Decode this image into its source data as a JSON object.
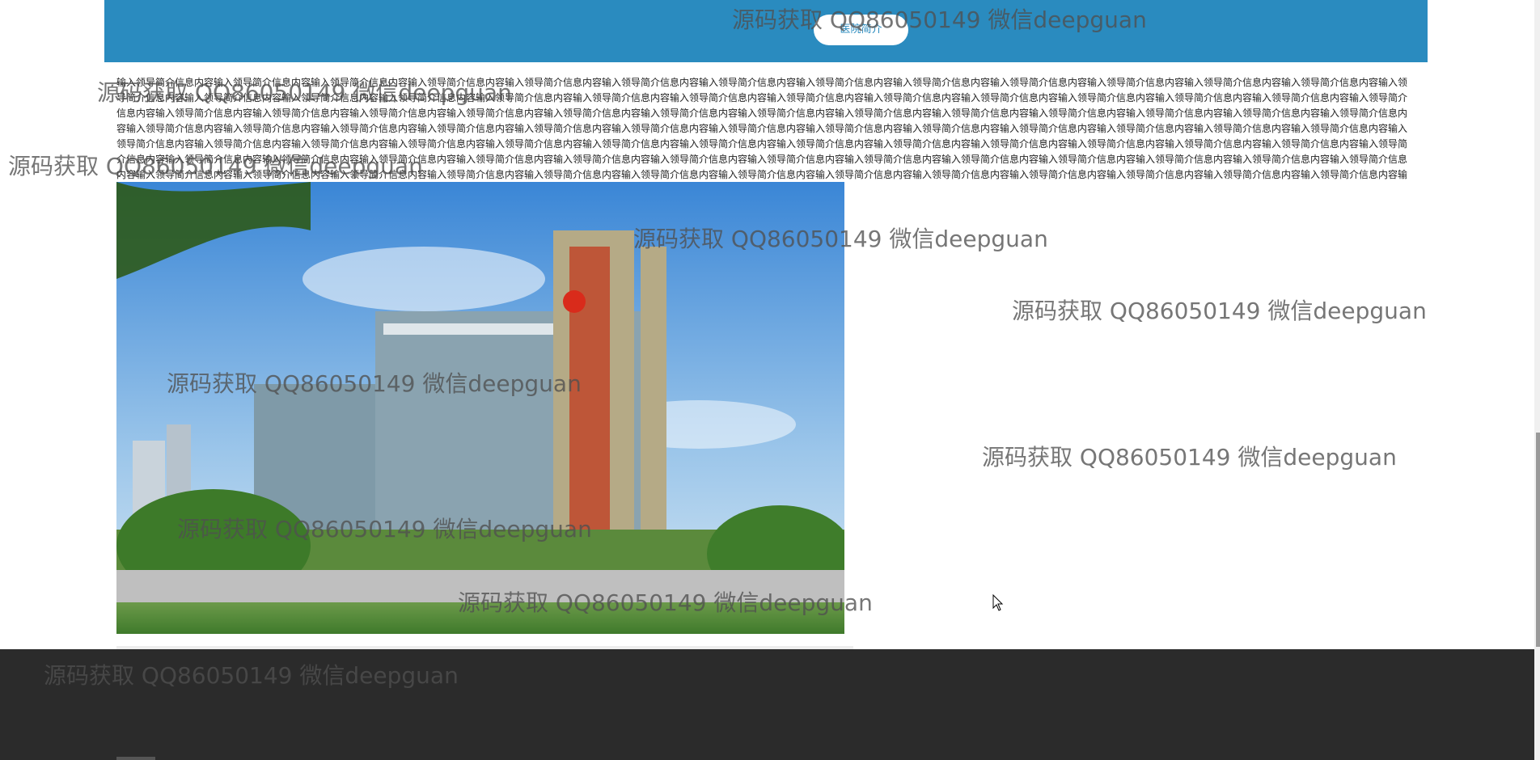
{
  "banner": {
    "color": "#2a8bbf",
    "pill_label": "医院简介"
  },
  "intro": {
    "text": "输入领导简介信息内容输入领导简介信息内容输入领导简介信息内容输入领导简介信息内容输入领导简介信息内容输入领导简介信息内容输入领导简介信息内容输入领导简介信息内容输入领导简介信息内容输入领导简介信息内容输入领导简介信息内容输入领导简介信息内容输入领导简介信息内容输入领导简介信息内容输入领导简介信息内容输入领导简介信息内容输入领导简介信息内容输入领导简介信息内容输入领导简介信息内容输入领导简介信息内容输入领导简介信息内容输入领导简介信息内容输入领导简介信息内容输入领导简介信息内容输入领导简介信息内容输入领导简介信息内容输入领导简介信息内容输入领导简介信息内容输入领导简介信息内容输入领导简介信息内容输入领导简介信息内容输入领导简介信息内容输入领导简介信息内容输入领导简介信息内容输入领导简介信息内容输入领导简介信息内容输入领导简介信息内容输入领导简介信息内容输入领导简介信息内容输入领导简介信息内容输入领导简介信息内容输入领导简介信息内容输入领导简介信息内容输入领导简介信息内容输入领导简介信息内容输入领导简介信息内容输入领导简介信息内容输入领导简介信息内容输入领导简介信息内容输入领导简介信息内容输入领导简介信息内容输入领导简介信息内容输入领导简介信息内容输入领导简介信息内容输入领导简介信息内容输入领导简介信息内容输入领导简介信息内容输入领导简介信息内容输入领导简介信息内容输入领导简介信息内容输入领导简介信息内容输入领导简介信息内容输入领导简介信息内容输入领导简介信息内容输入领导简介信息内容输入领导简介信息内容输入领导简介信息内容输入领导简介信息内容输入领导简介信息内容输入领导简介信息内容输入领导简介信息内容输入领导简介信息内容输入领导简介信息内容输入领导简介信息内容输入领导简介信息内容输入领导简介信息内容输入领导简介信息内容输入领导简介信息内容输入领导简介信息内容输入领导简介信息内容输入领导简介信息内容输入领导简介信息内容输入领导简介信息内容输入领导简介信息内容输入领导简介信息内容输入领导简介信息内容输入领导简介信息内容输入领导简介信息内容输入领导简介信息内容输入领导简介信息内容输入领导简介信息内容输入领导简介信息内容输入领导简介信息内容输入领导简介信息内容输入领导简介信息内容输入领导简介信息内容输入领导简介信息内容输入领导简介信息内容"
  },
  "watermark": {
    "text": "源码获取 QQ86050149 微信deepguan"
  },
  "colors": {
    "footer": "#2b2b2b",
    "banner": "#2a8bbf"
  },
  "icons": {
    "cursor": "arrow-cursor-icon"
  }
}
